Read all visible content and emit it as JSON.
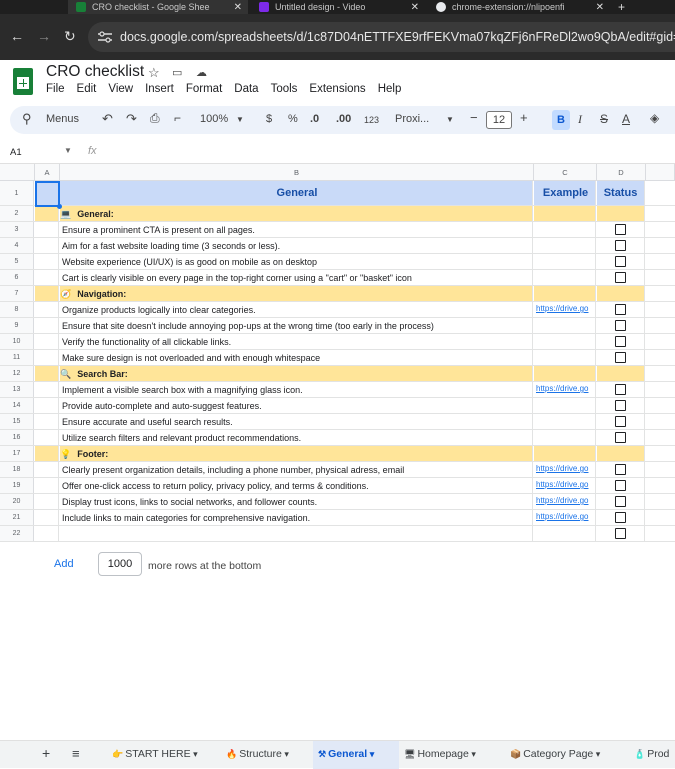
{
  "browser": {
    "tabs": [
      {
        "label": "CRO checklist - Google Shee"
      },
      {
        "label": "Untitled design - Video"
      },
      {
        "label": "chrome-extension://nlipoenfi"
      }
    ],
    "url": "docs.google.com/spreadsheets/d/1c87D04nETTFXE9rfFEKVma07kqZFj6nFReDl2wo9QbA/edit#gid=1639660"
  },
  "app": {
    "title": "CRO checklist",
    "menus": [
      "File",
      "Edit",
      "View",
      "Insert",
      "Format",
      "Data",
      "Tools",
      "Extensions",
      "Help"
    ]
  },
  "toolbar": {
    "menus_label": "Menus",
    "zoom": "100%",
    "currency": "$",
    "percent": "%",
    "dec_minus": ".0",
    "dec_plus": ".00",
    "numfmt": "123",
    "font": "Proxi...",
    "font_size": "12",
    "bold": "B",
    "italic": "I",
    "strike": "S",
    "text_color": "A"
  },
  "formula_bar": {
    "cell_ref": "A1",
    "fx": "fx"
  },
  "grid": {
    "columns": [
      "A",
      "B",
      "C",
      "D"
    ],
    "header": {
      "b": "General",
      "c": "Example",
      "d": "Status"
    },
    "rows": [
      {
        "num": "2",
        "type": "section",
        "icon": "💻",
        "text": "General:"
      },
      {
        "num": "3",
        "type": "item",
        "text": "Ensure a prominent CTA is present on all pages.",
        "link": ""
      },
      {
        "num": "4",
        "type": "item",
        "text": "Aim for a fast website loading time (3 seconds or less).",
        "link": ""
      },
      {
        "num": "5",
        "type": "item",
        "text": "Website experience (UI/UX) is as good on mobile as on desktop",
        "link": ""
      },
      {
        "num": "6",
        "type": "item",
        "text": "Cart is clearly visible on every page in the top-right corner using a \"cart\" or \"basket\" icon",
        "link": ""
      },
      {
        "num": "7",
        "type": "section",
        "icon": "🧭",
        "text": "Navigation:"
      },
      {
        "num": "8",
        "type": "item",
        "text": "Organize products logically into clear categories.",
        "link": "https://drive.go"
      },
      {
        "num": "9",
        "type": "item",
        "text": "Ensure that site doesn't include annoying pop-ups at the wrong time (too early in the process)",
        "link": ""
      },
      {
        "num": "10",
        "type": "item",
        "text": "Verify the functionality of all clickable links.",
        "link": ""
      },
      {
        "num": "11",
        "type": "item",
        "text": "Make sure design is not overloaded and with enough whitespace",
        "link": ""
      },
      {
        "num": "12",
        "type": "section",
        "icon": "🔍",
        "text": "Search Bar:"
      },
      {
        "num": "13",
        "type": "item",
        "text": "Implement a visible search box with a magnifying glass icon.",
        "link": "https://drive.go"
      },
      {
        "num": "14",
        "type": "item",
        "text": "Provide auto-complete and auto-suggest features.",
        "link": ""
      },
      {
        "num": "15",
        "type": "item",
        "text": "Ensure accurate and useful search results.",
        "link": ""
      },
      {
        "num": "16",
        "type": "item",
        "text": "Utilize search filters and relevant product recommendations.",
        "link": ""
      },
      {
        "num": "17",
        "type": "section",
        "icon": "💡",
        "text": "Footer:"
      },
      {
        "num": "18",
        "type": "item",
        "text": "Clearly present organization details, including a phone number, physical adress, email",
        "link": "https://drive.go"
      },
      {
        "num": "19",
        "type": "item",
        "text": "Offer one-click access to return policy, privacy policy, and terms & conditions.",
        "link": "https://drive.go"
      },
      {
        "num": "20",
        "type": "item",
        "text": "Display trust icons, links to social networks, and follower counts.",
        "link": "https://drive.go"
      },
      {
        "num": "21",
        "type": "item",
        "text": "Include links to main categories for comprehensive navigation.",
        "link": "https://drive.go"
      },
      {
        "num": "22",
        "type": "item",
        "text": "",
        "link": ""
      }
    ]
  },
  "add_rows": {
    "add_label": "Add",
    "count": "1000",
    "suffix": "more rows at the bottom"
  },
  "sheets": {
    "plus": "+",
    "list": "≡",
    "tabs": [
      {
        "icon": "👉",
        "label": "START HERE"
      },
      {
        "icon": "🔥",
        "label": "Structure"
      },
      {
        "icon": "⚒",
        "label": "General"
      },
      {
        "icon": "🖥",
        "label": "Homepage"
      },
      {
        "icon": "📦",
        "label": "Category Page"
      },
      {
        "icon": "🧴",
        "label": "Prod"
      }
    ]
  }
}
